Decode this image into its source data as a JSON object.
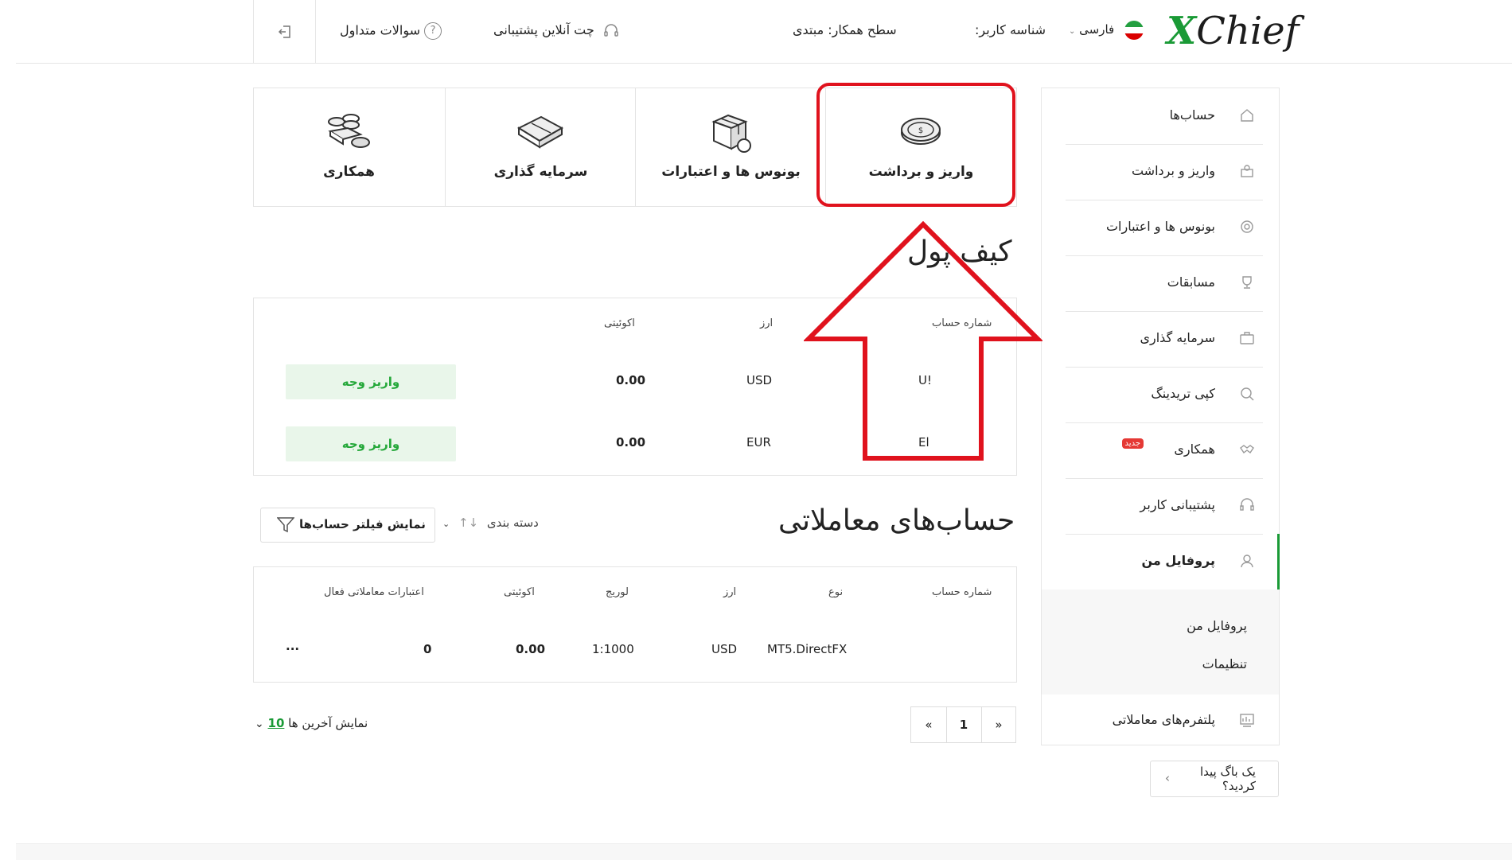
{
  "header": {
    "logo_x": "X",
    "logo_rest": "Chief",
    "language": "فارسی",
    "user_id_label": "شناسه کاربر:",
    "partner_level": "سطح همکار: مبتدی",
    "support_chat": "چت آنلاین پشتیبانی",
    "faq": "سوالات متداول"
  },
  "cards": [
    {
      "label": "واریز و برداشت",
      "icon": "coin-icon"
    },
    {
      "label": "بونوس ها و اعتبارات",
      "icon": "gift-box-icon"
    },
    {
      "label": "سرمایه گذاری",
      "icon": "briefcase-icon"
    },
    {
      "label": "همکاری",
      "icon": "coins-stack-icon"
    }
  ],
  "sidebar": {
    "items": [
      {
        "label": "حساب‌ها",
        "icon": "accounts-icon"
      },
      {
        "label": "واریز و برداشت",
        "icon": "deposit-icon"
      },
      {
        "label": "بونوس ها و اعتبارات",
        "icon": "bonus-icon"
      },
      {
        "label": "مسابقات",
        "icon": "trophy-icon"
      },
      {
        "label": "سرمایه گذاری",
        "icon": "briefcase-icon"
      },
      {
        "label": "کپی تریدینگ",
        "icon": "copy-trading-icon"
      },
      {
        "label": "همکاری",
        "icon": "handshake-icon",
        "badge": "جدید"
      },
      {
        "label": "پشتیبانی کاربر",
        "icon": "headset-icon"
      },
      {
        "label": "پروفایل من",
        "icon": "user-icon"
      }
    ],
    "sub_items": [
      "پروفایل من",
      "تنظیمات"
    ],
    "platforms": "پلتفرم‌های معاملاتی"
  },
  "wallet": {
    "title": "کیف پول",
    "headers": {
      "account": "شماره حساب",
      "currency": "ارز",
      "equity": "اکوئیتی"
    },
    "rows": [
      {
        "account": "U!",
        "currency": "USD",
        "equity": "0.00",
        "action": "واریز وجه"
      },
      {
        "account": "El",
        "currency": "EUR",
        "equity": "0.00",
        "action": "واریز وجه"
      }
    ]
  },
  "trading": {
    "title": "حساب‌های معاملاتی",
    "sort_label": "دسته بندی",
    "filter_label": "نمایش فیلتر حساب‌ها",
    "headers": {
      "account": "شماره حساب",
      "type": "نوع",
      "currency": "ارز",
      "leverage": "لوریج",
      "equity": "اکوئیتی",
      "credit": "اعتبارات معاملاتی فعال"
    },
    "rows": [
      {
        "account": "",
        "type": "MT5.DirectFX",
        "currency": "USD",
        "leverage": "1:1000",
        "equity": "0.00",
        "credit": "0",
        "more": "..."
      }
    ]
  },
  "pagination": {
    "prev": "«",
    "page": "1",
    "next": "»"
  },
  "show_last": {
    "label": "نمایش آخرین ها",
    "count": "10"
  },
  "bug_report": {
    "line1": "یک باگ پیدا",
    "line2": "کردید؟"
  },
  "colors": {
    "accent": "#1a9a36",
    "annotation": "#e0121d",
    "button_bg": "#e9f6ea"
  }
}
